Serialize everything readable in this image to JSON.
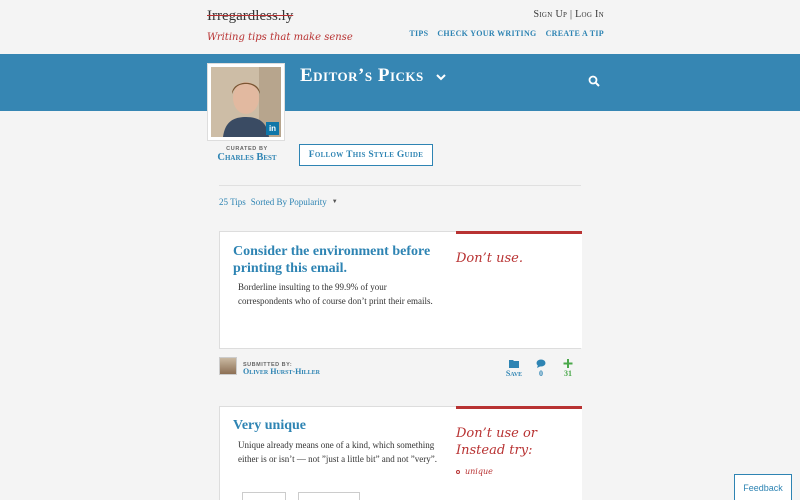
{
  "header": {
    "logo": "Irregardless.ly",
    "tagline": "Writing tips that make sense",
    "account": {
      "sign_up": "Sign Up",
      "separator": "|",
      "log_in": "Log In"
    },
    "nav": [
      "Tips",
      "Check Your Writing",
      "Create a Tip"
    ]
  },
  "band": {
    "title": "Editor’s Picks"
  },
  "curator": {
    "label": "CURATED BY",
    "name": "Charles Best",
    "follow_button": "Follow This Style Guide",
    "linkedin": "in"
  },
  "listing": {
    "count": "25 Tips",
    "sort_label": "Sorted By Popularity"
  },
  "tips": [
    {
      "title": "Consider the environment before printing this email.",
      "body": "Borderline insulting to the 99.9% of your correspondents who of course don’t print their emails.",
      "verdict": "Don’t use.",
      "submitted_label": "SUBMITTED BY:",
      "submitter": "Oliver Hurst-Hiller",
      "save_label": "Save",
      "comments": "0",
      "votes": "31"
    },
    {
      "title": "Very unique",
      "body": "Unique already means one of a kind, which something either is or isn’t — not ”just a little bit” and not ”very”.",
      "verdict": "Don’t use or Instead try:",
      "suggestion": "unique"
    }
  ],
  "feedback": "Feedback",
  "colors": {
    "brand_blue": "#3686b3",
    "link_blue": "#2e84b3",
    "accent_red": "#b83232",
    "plus_green": "#4aa84a"
  }
}
